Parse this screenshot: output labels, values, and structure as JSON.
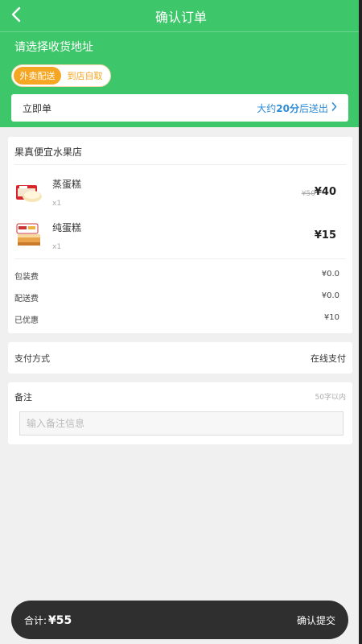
{
  "header": {
    "title": "确认订单",
    "back_icon": "chevron-left-icon"
  },
  "address": {
    "prompt": "请选择收货地址"
  },
  "delivery_mode": {
    "options": [
      "外卖配送",
      "到店自取"
    ],
    "selected": "外卖配送"
  },
  "delivery_time": {
    "label": "立即单",
    "eta_prefix": "大约",
    "eta_bold": "20分",
    "eta_suffix": "后送出"
  },
  "store": {
    "name": "果真便宜水果店",
    "items": [
      {
        "name": "蒸蛋糕",
        "qty": "x1",
        "original_price": "¥50",
        "price": "¥40"
      },
      {
        "name": "纯蛋糕",
        "qty": "x1",
        "original_price": "",
        "price": "¥15"
      }
    ],
    "fees": [
      {
        "label": "包装费",
        "value": "¥0.0"
      },
      {
        "label": "配送费",
        "value": "¥0.0"
      },
      {
        "label": "已优惠",
        "value": "¥10"
      }
    ]
  },
  "payment": {
    "label": "支付方式",
    "value": "在线支付"
  },
  "note": {
    "label": "备注",
    "limit": "50字以内",
    "placeholder": "输入备注信息"
  },
  "footer": {
    "total_label": "合计:",
    "total_value": "¥55",
    "submit_label": "确认提交"
  },
  "colors": {
    "brand_green": "#3dc76a",
    "accent_orange": "#f5a623",
    "link_blue": "#2e8bd6",
    "bar_dark": "#2f2f2f"
  }
}
